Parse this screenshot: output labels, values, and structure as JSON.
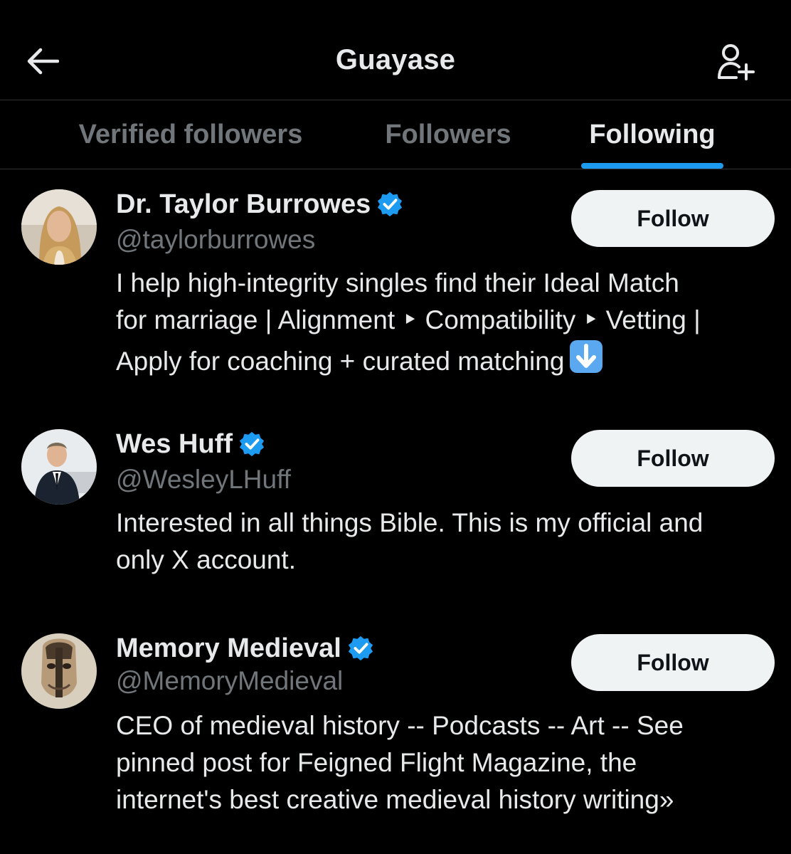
{
  "header": {
    "title": "Guayase",
    "back_icon": "arrow-left-icon",
    "add_icon": "person-add-icon"
  },
  "tabs": [
    {
      "label": "Verified followers",
      "active": false
    },
    {
      "label": "Followers",
      "active": false
    },
    {
      "label": "Following",
      "active": true
    }
  ],
  "colors": {
    "background": "#000000",
    "text_primary": "#e7e9ea",
    "text_secondary": "#71767b",
    "accent": "#1d9bf0",
    "button_bg": "#eff3f4",
    "button_text": "#0f1419"
  },
  "users": [
    {
      "name": "Dr. Taylor Burrowes",
      "handle": "@taylorburrowes",
      "verified": true,
      "bio_lines": [
        "I help high-integrity singles find their Ideal Match",
        "for marriage | Alignment ‣ Compatibility ‣ Vetting |",
        "Apply for coaching + curated matching"
      ],
      "bio_emoji": "down-arrow-emoji",
      "follow_label": "Follow"
    },
    {
      "name": "Wes Huff",
      "handle": "@WesleyLHuff",
      "verified": true,
      "bio_lines": [
        "Interested in all things Bible. This is my official and",
        "only X account."
      ],
      "follow_label": "Follow"
    },
    {
      "name": "Memory Medieval",
      "handle": "@MemoryMedieval",
      "verified": true,
      "bio_lines": [
        "CEO of medieval history -- Podcasts -- Art -- See",
        "pinned post for Feigned Flight Magazine, the",
        "internet's best creative medieval history writing»"
      ],
      "follow_label": "Follow"
    }
  ]
}
